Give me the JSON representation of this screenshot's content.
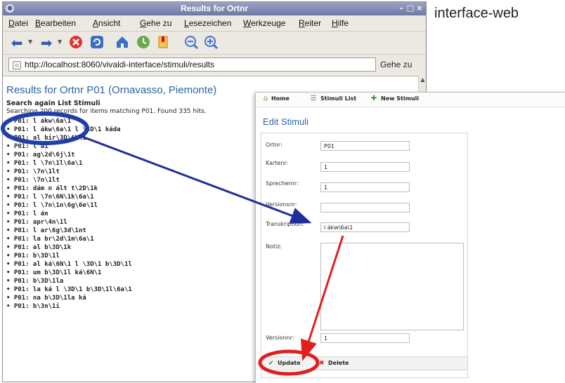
{
  "window": {
    "title": "Results for Ortnr",
    "controls": [
      "–",
      "□",
      "×"
    ]
  },
  "menu": [
    "Datei",
    "Bearbeiten",
    "Ansicht",
    "Gehe zu",
    "Lesezeichen",
    "Werkzeuge",
    "Reiter",
    "Hilfe"
  ],
  "address": {
    "url": "http://localhost:8060/vivaldi-interface/stimuli/results",
    "go_label": "Gehe zu"
  },
  "page": {
    "heading": "Results for Ortnr P01 (Ornavasso, Piemonte)",
    "search_again": "Search again List Stimuli",
    "summary": "Searching 200 records for items matching P01. Found 335 hits.",
    "results": [
      "P01: l ákw\\6a\\1",
      "P01: l ákw\\6a\\1 l \\3D\\1 káda",
      "P01: al bir\\3D\\6N\\1",
      "P01: l ái",
      "P01: ag\\2d\\6j\\1t",
      "P01: l \\7n\\1l\\6a\\1",
      "P01: \\7n\\1lt",
      "P01: \\7n\\1lt",
      "P01: dám n ált t\\2D\\1k",
      "P01: l \\7n\\6N\\1k\\6a\\1",
      "P01: l \\7n\\1n\\6g\\6e\\1l",
      "P01: l án",
      "P01: apr\\4n\\1l",
      "P01: l ar\\6g\\3d\\1nt",
      "P01: la br\\2d\\1m\\6a\\1",
      "P01: al b\\3D\\1k",
      "P01: b\\3D\\1l",
      "P01: al ká\\6N\\1 l \\3D\\1 b\\3D\\1l",
      "P01: um b\\3D\\1l ká\\6N\\1",
      "P01: b\\3D\\1la",
      "P01: la ká l \\3D\\1 b\\3D\\1l\\6a\\1",
      "P01: na b\\3D\\1la ká",
      "P01: b\\3n\\1i"
    ]
  },
  "caption": "interface-web",
  "edit": {
    "nav": {
      "home": "Home",
      "list": "Stimuli List",
      "new": "New Stimuli"
    },
    "title": "Edit Stimuli",
    "fields": {
      "ortnr": {
        "label": "Ortnr:",
        "value": "P01"
      },
      "kartenr": {
        "label": "Kartenr:",
        "value": "1"
      },
      "sprechernr": {
        "label": "Sprechernr:",
        "value": "1"
      },
      "versionsnr": {
        "label": "Versionsnr:",
        "value": ""
      },
      "transkription": {
        "label": "Transkription:",
        "value": "l ákw\\6a\\1"
      },
      "notiz": {
        "label": "Notiz:",
        "value": ""
      },
      "versionnr": {
        "label": "Versionnr:",
        "value": "1"
      }
    },
    "buttons": {
      "update": "Update",
      "delete": "Delete"
    }
  },
  "colors": {
    "highlight_ellipse": "#1f3fa8",
    "connector_blue": "#1f2e9a",
    "connector_red": "#e02020",
    "title_blue": "#2c64a6"
  }
}
